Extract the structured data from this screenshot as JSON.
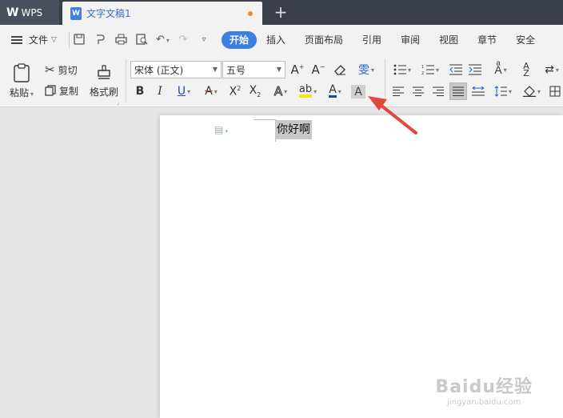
{
  "app": {
    "logo": "W",
    "name": "WPS"
  },
  "document_tab": {
    "icon": "W",
    "title": "文字文稿1",
    "new_tab_symbol": "+"
  },
  "menubar": {
    "file_label": "文件",
    "ribbon_tabs": [
      "开始",
      "插入",
      "页面布局",
      "引用",
      "审阅",
      "视图",
      "章节",
      "安全"
    ],
    "active_tab": "开始"
  },
  "clipboard": {
    "paste_label": "粘贴",
    "cut_label": "剪切",
    "copy_label": "复制",
    "format_painter_label": "格式刷"
  },
  "font": {
    "family_value": "宋体 (正文)",
    "size_value": "五号",
    "phonetic_glyph": "雯",
    "font_color": "#1e3fbf",
    "highlight_color": "#f5e617",
    "active_button": "char-shading"
  },
  "document": {
    "text": "你好啊",
    "selected": true
  },
  "annotation": {
    "arrow_color": "#e04a3a"
  },
  "watermark": {
    "main": "Baidu经验",
    "sub": "jingyan.baidu.com"
  }
}
